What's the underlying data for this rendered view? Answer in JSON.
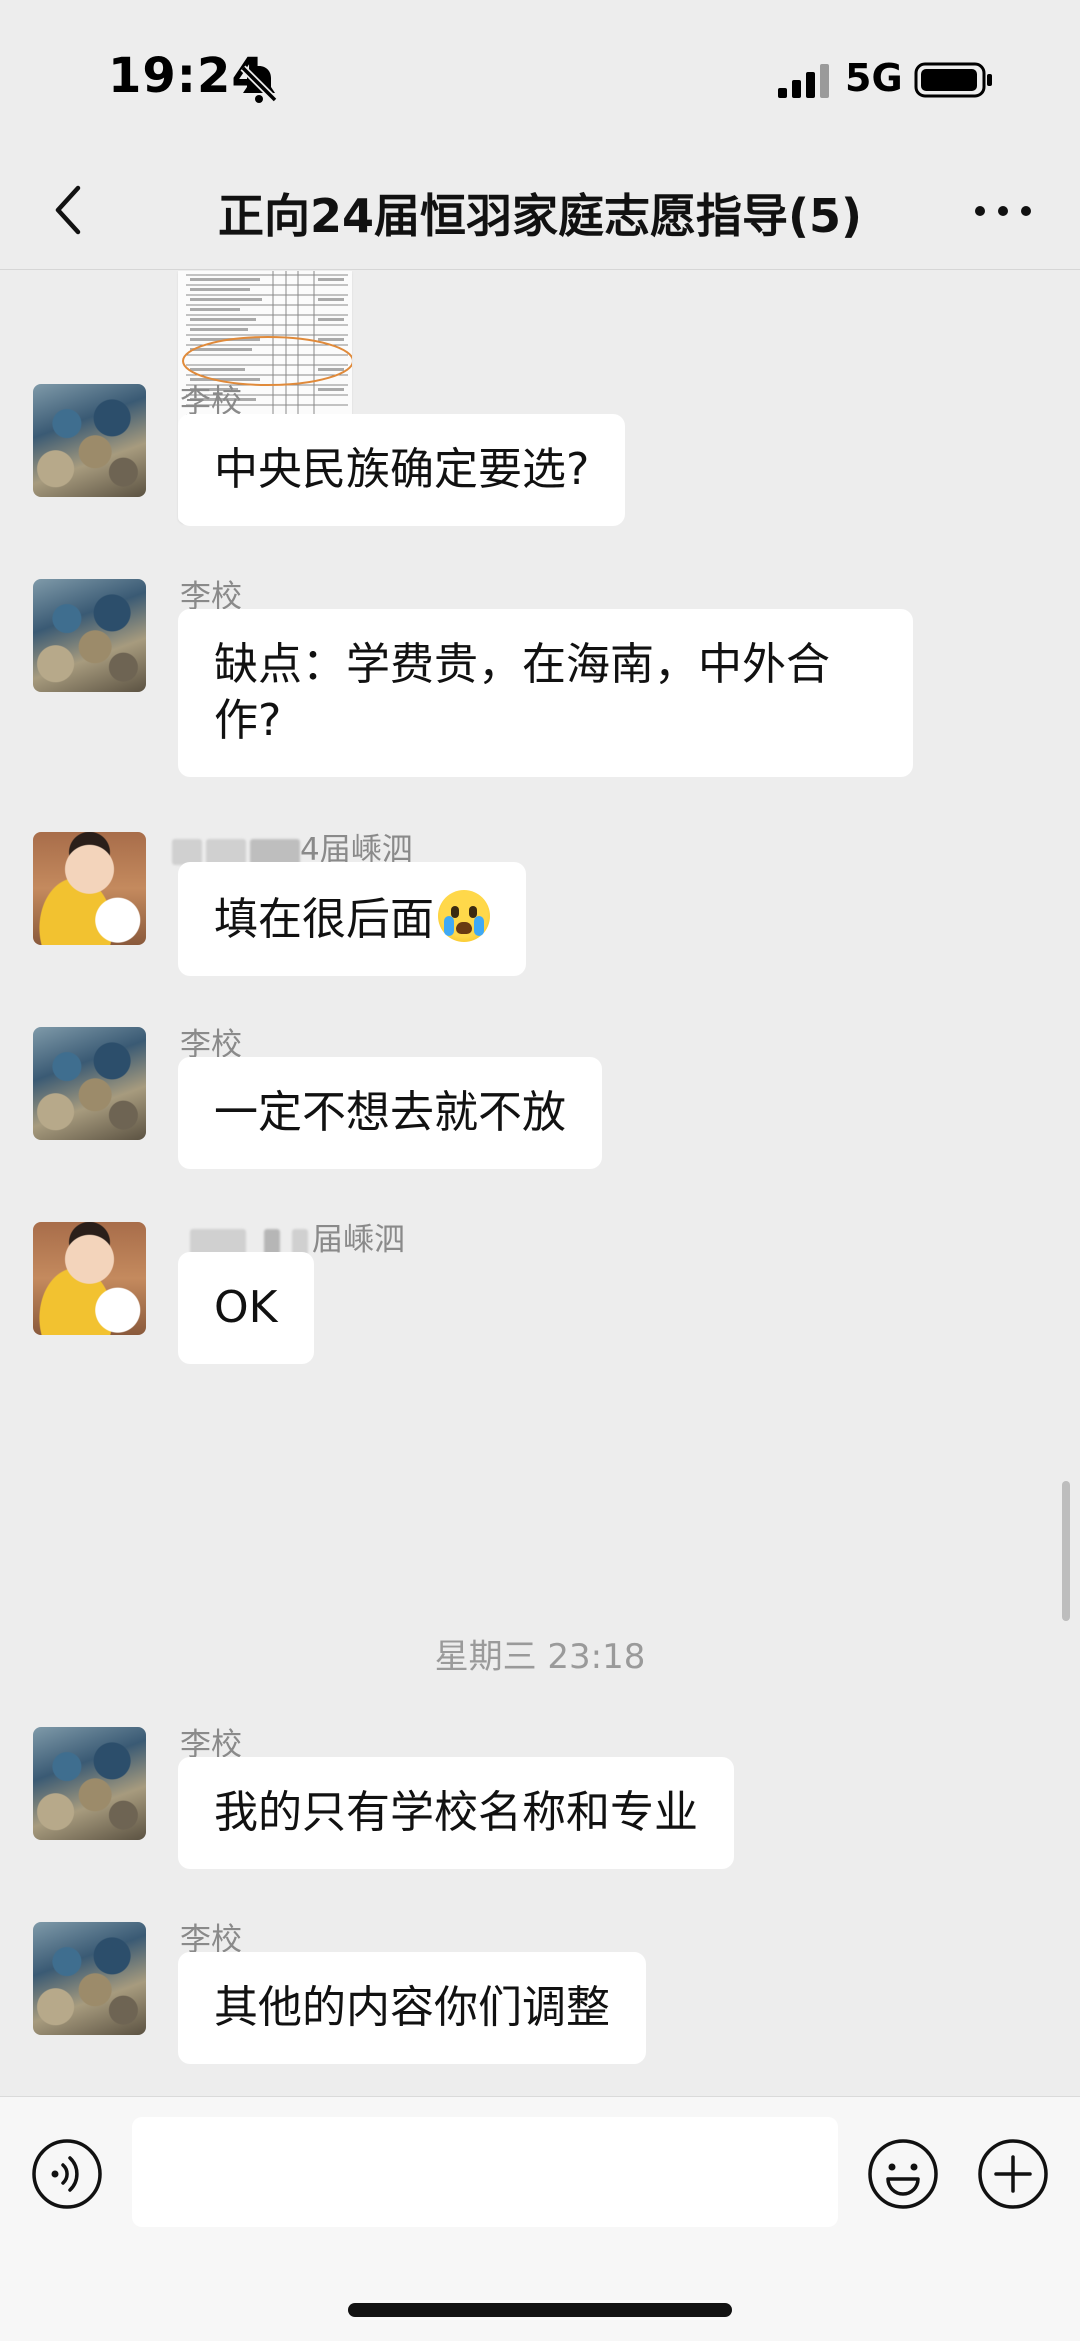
{
  "status_bar": {
    "time": "19:24",
    "network": "5G"
  },
  "nav": {
    "title": "正向24届恒羽家庭志愿指导(5)"
  },
  "messages": [
    {
      "sender": "李校",
      "text": "中央民族确定要选?"
    },
    {
      "sender": "李校",
      "text": "缺点：学费贵，在海南，中外合作?"
    },
    {
      "sender_visible": "4届嵊泗",
      "text": "填在很后面"
    },
    {
      "sender": "李校",
      "text": "一定不想去就不放"
    },
    {
      "sender_visible": "届嵊泗",
      "text": "OK"
    },
    {
      "sender": "李校",
      "text": "我的只有学校名称和专业"
    },
    {
      "sender": "李校",
      "text": "其他的内容你们调整"
    }
  ],
  "timestamp": "星期三 23:18",
  "icons": {
    "back": "chevron-left-icon",
    "more": "more-dots-icon",
    "silent": "bell-slash-icon",
    "voice": "voice-icon",
    "emoji": "emoji-icon",
    "plus": "plus-circle-icon"
  },
  "colors": {
    "background": "#EDEDED",
    "bubble": "#FFFFFF",
    "input_bar": "#F7F7F7",
    "sender_name": "#8A8A8A",
    "drawing_circle": "#E08A3A"
  }
}
